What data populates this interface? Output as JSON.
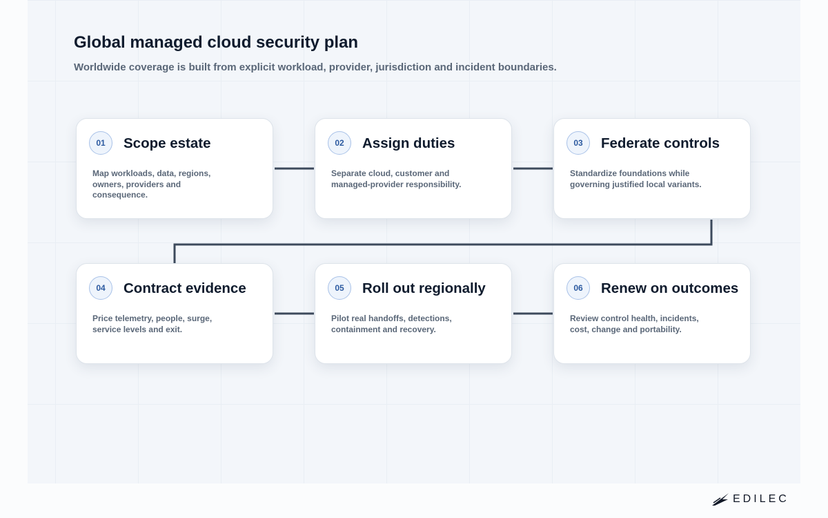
{
  "header": {
    "title": "Global managed cloud security plan",
    "subtitle": "Worldwide coverage is built from explicit workload, provider, jurisdiction and incident boundaries."
  },
  "steps": [
    {
      "number": "01",
      "title": "Scope estate",
      "description": "Map workloads, data, regions, owners, providers and consequence."
    },
    {
      "number": "02",
      "title": "Assign duties",
      "description": "Separate cloud, customer and managed-provider responsibility."
    },
    {
      "number": "03",
      "title": "Federate controls",
      "description": "Standardize foundations while governing justified local variants."
    },
    {
      "number": "04",
      "title": "Contract evidence",
      "description": "Price telemetry, people, surge, service levels and exit."
    },
    {
      "number": "05",
      "title": "Roll out regionally",
      "description": "Pilot real handoffs, detections, containment and recovery."
    },
    {
      "number": "06",
      "title": "Renew on outcomes",
      "description": "Review control health, incidents, cost, change and portability."
    }
  ],
  "brand": {
    "logo_text": "EDILEC",
    "icon": "edilec-logo-mark"
  },
  "colors": {
    "connector": "#3d4a5c",
    "badge_border": "#a9c2e8",
    "badge_text": "#2c5aa0"
  }
}
